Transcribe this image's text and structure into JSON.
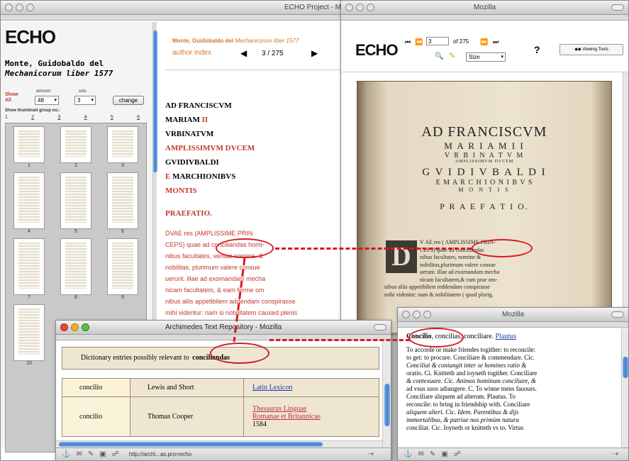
{
  "echo_window": {
    "title": "ECHO Project - M",
    "logo": "ECHO",
    "author": "Monte, Guidobaldo del",
    "work": "Mechanicorum liber 1577",
    "show_all": "Show All",
    "dropdown1_label": "amount",
    "dropdown1_value": "48",
    "dropdown2_label": "cols",
    "dropdown2_value": "3",
    "change_button": "change",
    "thumbnail_group_label": "Show thumbnail group no.:",
    "group_numbers": [
      "1",
      "2",
      "3",
      "4",
      "5",
      "6"
    ],
    "thumbnail_labels": [
      "1",
      "2",
      "3",
      "4",
      "5",
      "6",
      "7",
      "8",
      "9",
      "10"
    ],
    "header_author": "Monte, Guidobaldo del",
    "header_work": "Mechanicorum liber 1577",
    "author_index": "author index",
    "page_counter": "3 / 275",
    "text_title_lines": [
      {
        "black": "AD FRANCISCVM",
        "red": ""
      },
      {
        "black": "MARIAM ",
        "red": "II"
      },
      {
        "black": "VRBINATVM",
        "red": ""
      },
      {
        "black": "",
        "red": "AMPLISSIMVM DVCEM"
      },
      {
        "black": "GVIDIVBALDI",
        "red": ""
      },
      {
        "black": "",
        "red": "E"
      },
      {
        "black": " MARCHIONIBVS",
        "red": ""
      },
      {
        "black": "",
        "red": "MONTIS"
      }
    ],
    "praefatio": "PRAEFATIO.",
    "body_lines": [
      "DVAE res (AMPLISSIME PRIN",
      "CEPS) quae ad conciliandas homi-",
      "nibus facultates, ventae nomine, &",
      "nobilitas, plurimum valere consue",
      "uerunt. illae ad exornandam mecha",
      "nicam facultatem, & eam ferme om",
      "nibus aliis appetibilem addendam conspirasse",
      "mihi videntur: nam si nobilitatem caused plenis"
    ]
  },
  "mozilla_viewer": {
    "title": "Mozilla",
    "logo": "ECHO",
    "page_input": "3",
    "of_pages": "of 275",
    "size_label": "Size",
    "help_icon": "?",
    "viewing_tools": "Viewing Tools",
    "scan_lines": [
      "AD FRANCISCVM",
      "M A R I A M  I I",
      "V R B I N A T V M",
      "AMPLISSIMVM DVCEM",
      "G V I D I V B A L D I",
      "E  M A R C H I O N I B V S",
      "M O N T I S",
      "P R A E F A T I O."
    ],
    "scan_body_lines": [
      "V AE res ( AMPLISSIME PRIN-",
      "  CEPS) quae ad conciliandas",
      "  nibus facultates, nomine &",
      "  nobilitas,plurimum valere consue",
      "  uerunt. illae ad exornandam mecha",
      "  nicam facultatem,& eam prae om-",
      "nibus aliis appetibilem reddendam conspirasse",
      "mihi videntur: nam & nobilitatem ( quod plurig."
    ],
    "scan_highlight_word": "conciliandas",
    "drop_cap": "D"
  },
  "archimedes_window": {
    "title": "Archimedes Text Repository - Mozilla",
    "header_text": "Dictionary entries possibly relevant to",
    "header_word": "conciliandas",
    "rows": [
      {
        "lemma": "concilio",
        "dictionary": "Lewis and Short",
        "link1": "Latin Lexicon",
        "link2": "",
        "year": ""
      },
      {
        "lemma": "concilio",
        "dictionary": "Thomas Cooper",
        "link1": "Thesaurus Linguae",
        "link2": "Romanae et Britannicae",
        "year": "1584"
      }
    ],
    "status_url": "http://archi...as.pro=echo"
  },
  "mozilla_dict": {
    "title": "Mozilla",
    "headword": "Concilio",
    "headword_rest": ", concilias, conciliare.",
    "headword_link": "Plautus",
    "lines": [
      "To accorde or make friendes togither: to reconcile:",
      "to get: to procure. Conciliare & commendare. Cic.",
      "Conciliat & coniungit inter se homines ratio &",
      "oratio. Ci. Knitteth and ioyneth togither. Conciliare",
      "& contexuare. Cic. Animos hominum conciliare, &",
      "ad vsus suos adiungere. C. To winne mens fauours.",
      "Conciliare aliquem ad alterum. Plautus. To",
      "reconcile: to bring in friendship with. Conciliare",
      "aliquem alteri. Cic. Idem. Parentibus & dijs",
      "immortalibus, & patriae nos primùm natura",
      "conciliat. Cic. Ioyneth or knitteth vs to. Virtus"
    ]
  },
  "colors": {
    "annotation_red": "#d71920",
    "text_red": "#c0392b",
    "link_blue": "#1a3ca8",
    "scroll_blue": "#3e7fcf"
  }
}
